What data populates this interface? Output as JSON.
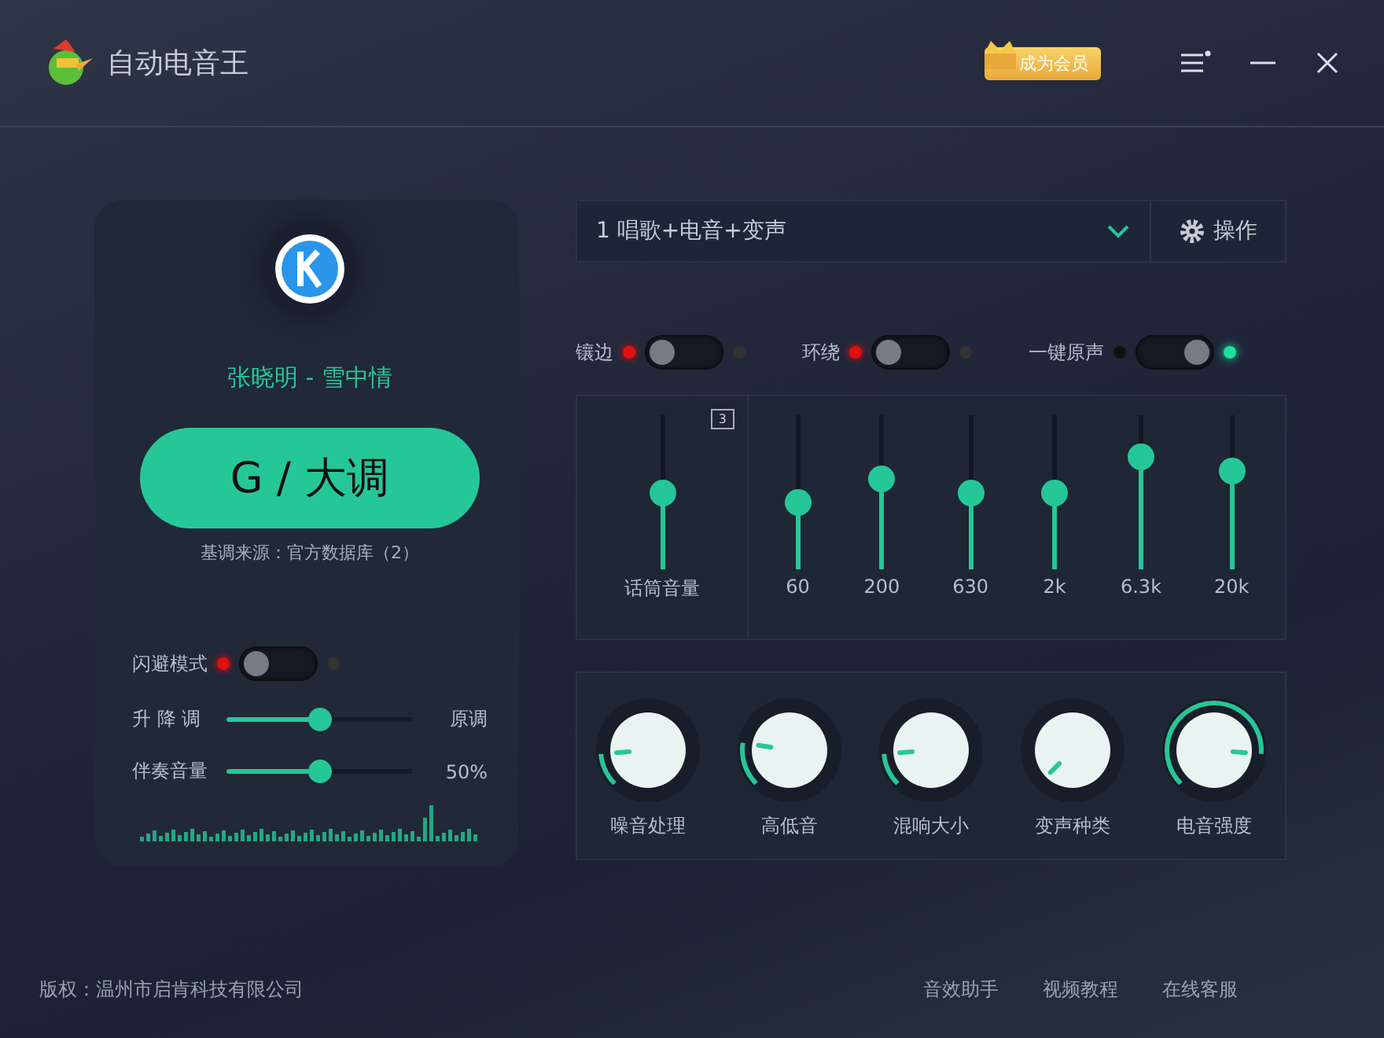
{
  "window": {
    "title": "自动电音王",
    "vip_badge": "成为会员"
  },
  "song": {
    "title": "张晓明 - 雪中情",
    "key": "G / 大调",
    "key_source": "基调来源：官方数据库（2）"
  },
  "dodge": {
    "label": "闪避模式",
    "on": false
  },
  "left_sliders": [
    {
      "label": "升 降 调",
      "level": 0.5,
      "reading": "原调"
    },
    {
      "label": "伴奏音量",
      "level": 0.5,
      "reading": "50%"
    }
  ],
  "preset": {
    "value": "1 唱歌+电音+变声",
    "button": "操作"
  },
  "switches": [
    {
      "label": "镶边",
      "on": false
    },
    {
      "label": "环绕",
      "on": false
    },
    {
      "label": "一键原声",
      "on": true
    }
  ],
  "mic": {
    "label": "话筒音量",
    "level": 0.5,
    "badge": "3"
  },
  "eq": [
    {
      "label": "60",
      "level": 0.42
    },
    {
      "label": "200",
      "level": 0.6
    },
    {
      "label": "630",
      "level": 0.5
    },
    {
      "label": "2k",
      "level": 0.5
    },
    {
      "label": "6.3k",
      "level": 0.78
    },
    {
      "label": "20k",
      "level": 0.67
    }
  ],
  "knobs": [
    {
      "label": "噪音处理"
    },
    {
      "label": "高低音"
    },
    {
      "label": "混响大小"
    },
    {
      "label": "变声种类"
    },
    {
      "label": "电音强度"
    }
  ],
  "footer": {
    "copyright": "版权：温州市启肯科技有限公司",
    "links": [
      "音效助手",
      "视频教程",
      "在线客服"
    ]
  }
}
